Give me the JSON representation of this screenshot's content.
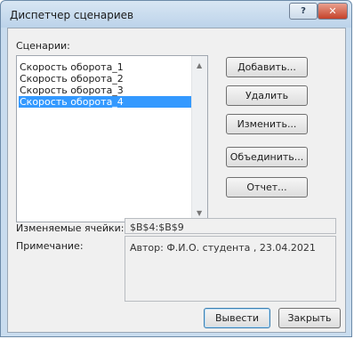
{
  "window": {
    "title": "Диспетчер сценариев",
    "help_icon_glyph": "?",
    "close_icon_glyph": "✕"
  },
  "scenarios": {
    "label": "Сценарии:",
    "items": [
      "Скорость оборота_1",
      "Скорость оборота_2",
      "Скорость оборота_3",
      "Скорость оборота_4"
    ],
    "selected_index": 3,
    "scroll_up_glyph": "▲",
    "scroll_down_glyph": "▼"
  },
  "buttons": {
    "add": "Добавить...",
    "delete": "Удалить",
    "edit": "Изменить...",
    "merge": "Объединить...",
    "report": "Отчет...",
    "show": "Вывести",
    "close": "Закрыть"
  },
  "changing_cells": {
    "label": "Изменяемые ячейки:",
    "value": "$B$4:$B$9"
  },
  "comment": {
    "label": "Примечание:",
    "value": "Автор: Ф.И.О. студента , 23.04.2021"
  },
  "colors": {
    "selection": "#3399ff",
    "close_button": "#c5422a"
  }
}
